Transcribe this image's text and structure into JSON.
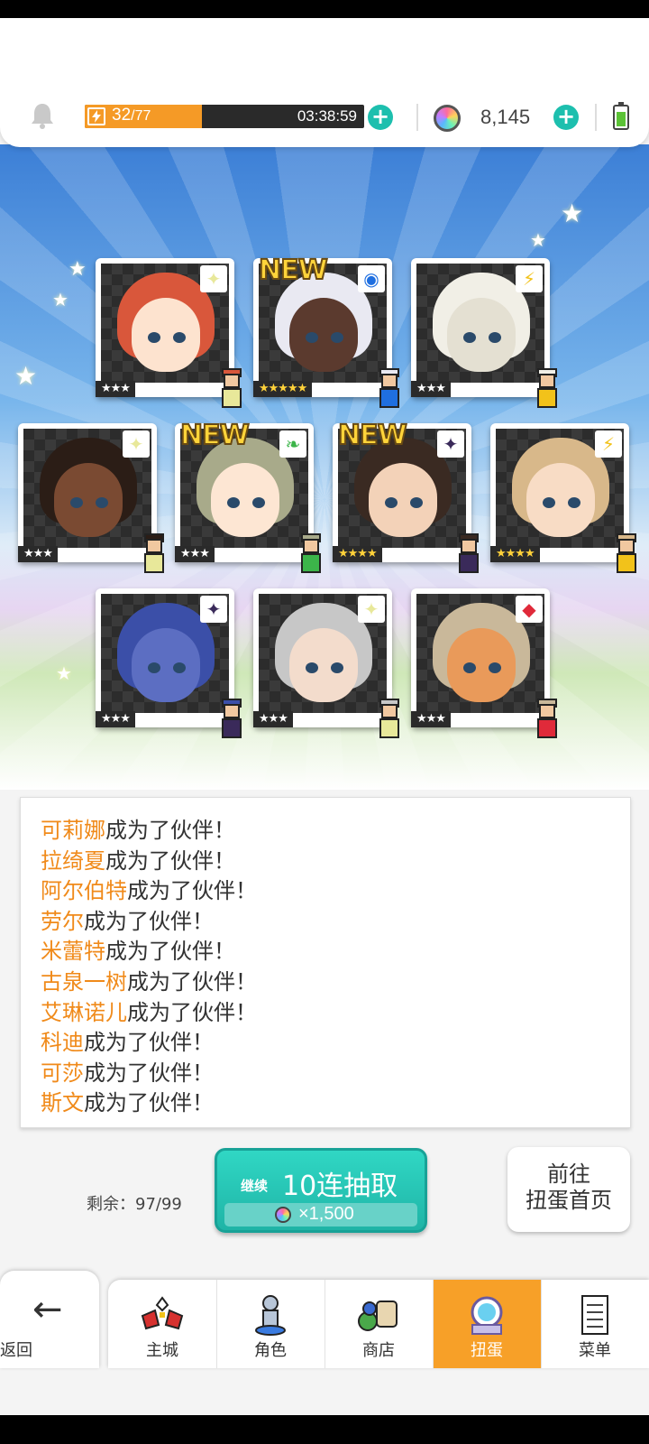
{
  "topbar": {
    "energy_current": "32",
    "energy_max": "/77",
    "energy_fraction": 0.42,
    "timer": "03:38:59",
    "gem_count": "8,145"
  },
  "colors": {
    "accent": "#1dbfae",
    "energy": "#f59a26",
    "highlight_name": "#f08a1a",
    "nav_active": "#f7a028"
  },
  "cards": [
    {
      "name_key": "card-1",
      "stars": "★★★",
      "gold": false,
      "new": false,
      "badge_icon": "sparkle-icon",
      "badge": "✦",
      "badge_color": "#e8e89a",
      "hair": "#d9573b",
      "skin": "#fde3cf"
    },
    {
      "name_key": "card-2",
      "stars": "★★★★★",
      "gold": true,
      "new": true,
      "badge_icon": "blue-circle-icon",
      "badge": "◉",
      "badge_color": "#1f6fe0",
      "hair": "#e9e9f2",
      "skin": "#5b3a2e"
    },
    {
      "name_key": "card-3",
      "stars": "★★★",
      "gold": false,
      "new": false,
      "badge_icon": "lightning-icon",
      "badge": "⚡",
      "badge_color": "#f2c21a",
      "hair": "#f1efe6",
      "skin": "#e4e0d2"
    },
    {
      "name_key": "card-4",
      "stars": "★★★",
      "gold": false,
      "new": false,
      "badge_icon": "sparkle-icon",
      "badge": "✦",
      "badge_color": "#e8e89a",
      "hair": "#2b1d16",
      "skin": "#7a4a32"
    },
    {
      "name_key": "card-5",
      "stars": "★★★",
      "gold": false,
      "new": true,
      "badge_icon": "leaf-icon",
      "badge": "❧",
      "badge_color": "#3cb54a",
      "hair": "#a8aa8a",
      "skin": "#fde6d3"
    },
    {
      "name_key": "card-6",
      "stars": "★★★★",
      "gold": true,
      "new": true,
      "badge_icon": "dark-star-icon",
      "badge": "✦",
      "badge_color": "#3a2a5a",
      "hair": "#3a2a22",
      "skin": "#f3d2b8"
    },
    {
      "name_key": "card-7",
      "stars": "★★★★",
      "gold": true,
      "new": false,
      "badge_icon": "lightning-icon",
      "badge": "⚡",
      "badge_color": "#f2c21a",
      "hair": "#d8b88a",
      "skin": "#f8dcc5"
    },
    {
      "name_key": "card-8",
      "stars": "★★★",
      "gold": false,
      "new": false,
      "badge_icon": "dark-star-icon",
      "badge": "✦",
      "badge_color": "#3a2a5a",
      "hair": "#3b4fa8",
      "skin": "#5c6ec2"
    },
    {
      "name_key": "card-9",
      "stars": "★★★",
      "gold": false,
      "new": false,
      "badge_icon": "sparkle-icon",
      "badge": "✦",
      "badge_color": "#e8e89a",
      "hair": "#c7c7c7",
      "skin": "#f3dccc"
    },
    {
      "name_key": "card-10",
      "stars": "★★★",
      "gold": false,
      "new": false,
      "badge_icon": "red-diamond-icon",
      "badge": "◆",
      "badge_color": "#e02a3a",
      "hair": "#c9b89a",
      "skin": "#e99a5a"
    }
  ],
  "new_label": "NEW",
  "log": [
    {
      "name": "可莉娜",
      "text": "成为了伙伴！"
    },
    {
      "name": "拉绮夏",
      "text": "成为了伙伴！"
    },
    {
      "name": "阿尔伯特",
      "text": "成为了伙伴！"
    },
    {
      "name": "劳尔",
      "text": "成为了伙伴！"
    },
    {
      "name": "米蕾特",
      "text": "成为了伙伴！"
    },
    {
      "name": "古泉一树",
      "text": "成为了伙伴！"
    },
    {
      "name": "艾琳诺儿",
      "text": "成为了伙伴！"
    },
    {
      "name": "科迪",
      "text": "成为了伙伴！"
    },
    {
      "name": "可莎",
      "text": "成为了伙伴！"
    },
    {
      "name": "斯文",
      "text": "成为了伙伴！"
    }
  ],
  "actions": {
    "remaining": "剩余：97/99",
    "continue_small": "继续",
    "pull_label": "10连抽取",
    "pull_cost": "×1,500",
    "home_line1": "前往",
    "home_line2": "扭蛋首页"
  },
  "nav": {
    "back": "返回",
    "items": [
      {
        "label": "主城",
        "icon": "castle-icon"
      },
      {
        "label": "角色",
        "icon": "character-icon"
      },
      {
        "label": "商店",
        "icon": "shop-icon"
      },
      {
        "label": "扭蛋",
        "icon": "gacha-icon",
        "active": true
      },
      {
        "label": "菜单",
        "icon": "menu-icon"
      }
    ]
  }
}
